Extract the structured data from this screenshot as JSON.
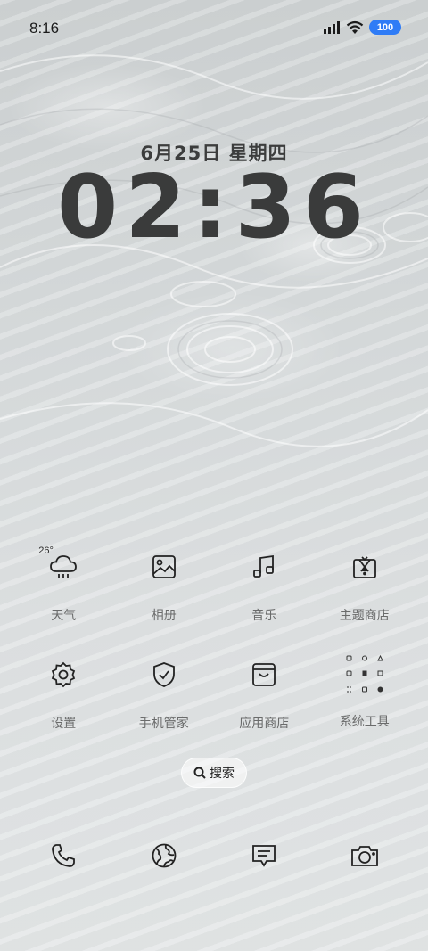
{
  "status_bar": {
    "time": "8:16",
    "battery": "100",
    "icons": [
      "signal-icon",
      "wifi-icon",
      "battery-icon"
    ]
  },
  "lockscreen": {
    "date": "6月25日 星期四",
    "clock": "02:36"
  },
  "apps": [
    {
      "label": "天气",
      "icon": "weather-cloud-icon",
      "badge": "26°"
    },
    {
      "label": "相册",
      "icon": "gallery-icon"
    },
    {
      "label": "音乐",
      "icon": "music-note-icon"
    },
    {
      "label": "主题商店",
      "icon": "theme-store-icon"
    },
    {
      "label": "设置",
      "icon": "gear-icon"
    },
    {
      "label": "手机管家",
      "icon": "shield-check-icon"
    },
    {
      "label": "应用商店",
      "icon": "app-store-icon"
    },
    {
      "label": "系统工具",
      "icon": "folder-grid-icon"
    }
  ],
  "search": {
    "label": "搜索",
    "icon": "search-icon"
  },
  "dock": [
    {
      "icon": "phone-icon"
    },
    {
      "icon": "browser-globe-icon"
    },
    {
      "icon": "messages-icon"
    },
    {
      "icon": "camera-icon"
    }
  ],
  "colors": {
    "accent": "#2f7cf6",
    "text_dark": "#3a3b3b",
    "label": "#6a6b6b"
  }
}
